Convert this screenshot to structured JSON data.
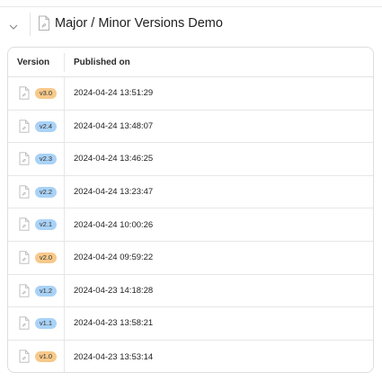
{
  "header": {
    "title": "Major / Minor Versions Demo",
    "collapse_icon": "chevron-down-icon",
    "doc_icon": "document-icon"
  },
  "table": {
    "columns": [
      "Version",
      "Published on"
    ],
    "rows": [
      {
        "version": "v3.0",
        "kind": "major",
        "published_on": "2024-04-24 13:51:29"
      },
      {
        "version": "v2.4",
        "kind": "minor",
        "published_on": "2024-04-24 13:48:07"
      },
      {
        "version": "v2.3",
        "kind": "minor",
        "published_on": "2024-04-24 13:46:25"
      },
      {
        "version": "v2.2",
        "kind": "minor",
        "published_on": "2024-04-24 13:23:47"
      },
      {
        "version": "v2.1",
        "kind": "minor",
        "published_on": "2024-04-24 10:00:26"
      },
      {
        "version": "v2.0",
        "kind": "major",
        "published_on": "2024-04-24 09:59:22"
      },
      {
        "version": "v1.2",
        "kind": "minor",
        "published_on": "2024-04-23 14:18:28"
      },
      {
        "version": "v1.1",
        "kind": "minor",
        "published_on": "2024-04-23 13:58:21"
      },
      {
        "version": "v1.0",
        "kind": "major",
        "published_on": "2024-04-23 13:53:14"
      }
    ]
  },
  "colors": {
    "major_badge": "#f7c98a",
    "minor_badge": "#a9d2f6",
    "border": "#dedede"
  }
}
